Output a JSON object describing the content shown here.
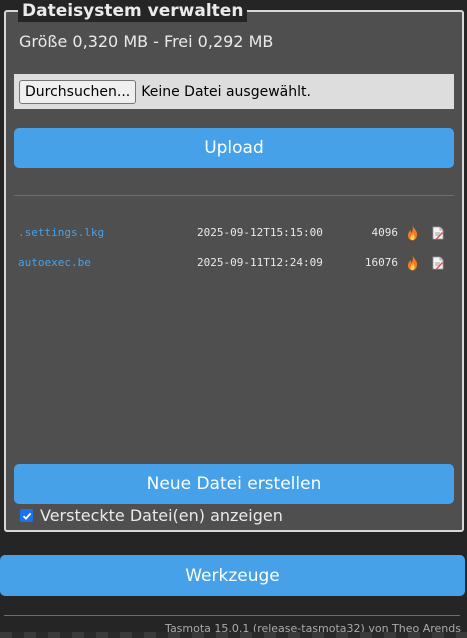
{
  "fieldset": {
    "legend": "Dateisystem verwalten",
    "size_line": "Größe 0,320 MB - Frei 0,292 MB"
  },
  "file_input": {
    "browse_label": "Durchsuchen...",
    "status": "Keine Datei ausgewählt."
  },
  "buttons": {
    "upload": "Upload",
    "new_file": "Neue Datei erstellen",
    "tools": "Werkzeuge"
  },
  "files": [
    {
      "name": ".settings.lkg",
      "date": "2025-09-12T15:15:00",
      "size": "4096"
    },
    {
      "name": "autoexec.be",
      "date": "2025-09-11T12:24:09",
      "size": "16076"
    }
  ],
  "hidden_files": {
    "checked": true,
    "label": "Versteckte Datei(en) anzeigen"
  },
  "footer": "Tasmota 15.0.1 (release-tasmota32) von Theo Arends",
  "colors": {
    "accent": "#47a1e8",
    "panel": "#4f4f4f",
    "background": "#252525"
  }
}
